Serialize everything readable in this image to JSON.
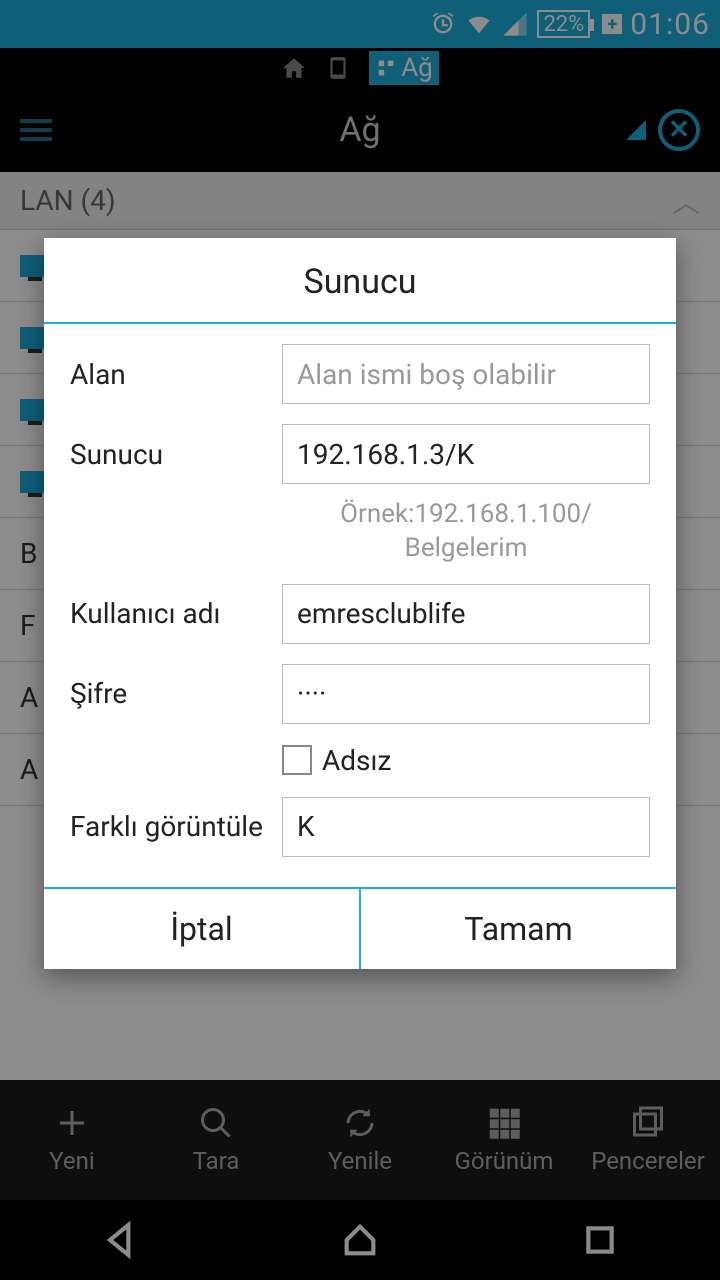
{
  "status": {
    "battery": "22%",
    "time": "01:06"
  },
  "tabs": {
    "network_label": "Ağ"
  },
  "header": {
    "title": "Ağ"
  },
  "section": {
    "lan": "LAN (4)"
  },
  "list": {
    "letters": [
      "B",
      "F",
      "A",
      "A"
    ]
  },
  "dialog": {
    "title": "Sunucu",
    "domain_label": "Alan",
    "domain_placeholder": "Alan ismi boş olabilir",
    "server_label": "Sunucu",
    "server_value": "192.168.1.3/K",
    "hint_line1": "Örnek:192.168.1.100/",
    "hint_line2": "Belgelerim",
    "user_label": "Kullanıcı adı",
    "user_value": "emresclublife",
    "pass_label": "Şifre",
    "pass_value": "····",
    "anon_label": "Adsız",
    "display_label": "Farklı görüntüle",
    "display_value": "K",
    "cancel": "İptal",
    "ok": "Tamam"
  },
  "toolbar": {
    "new": "Yeni",
    "scan": "Tara",
    "refresh": "Yenile",
    "view": "Görünüm",
    "windows": "Pencereler"
  }
}
